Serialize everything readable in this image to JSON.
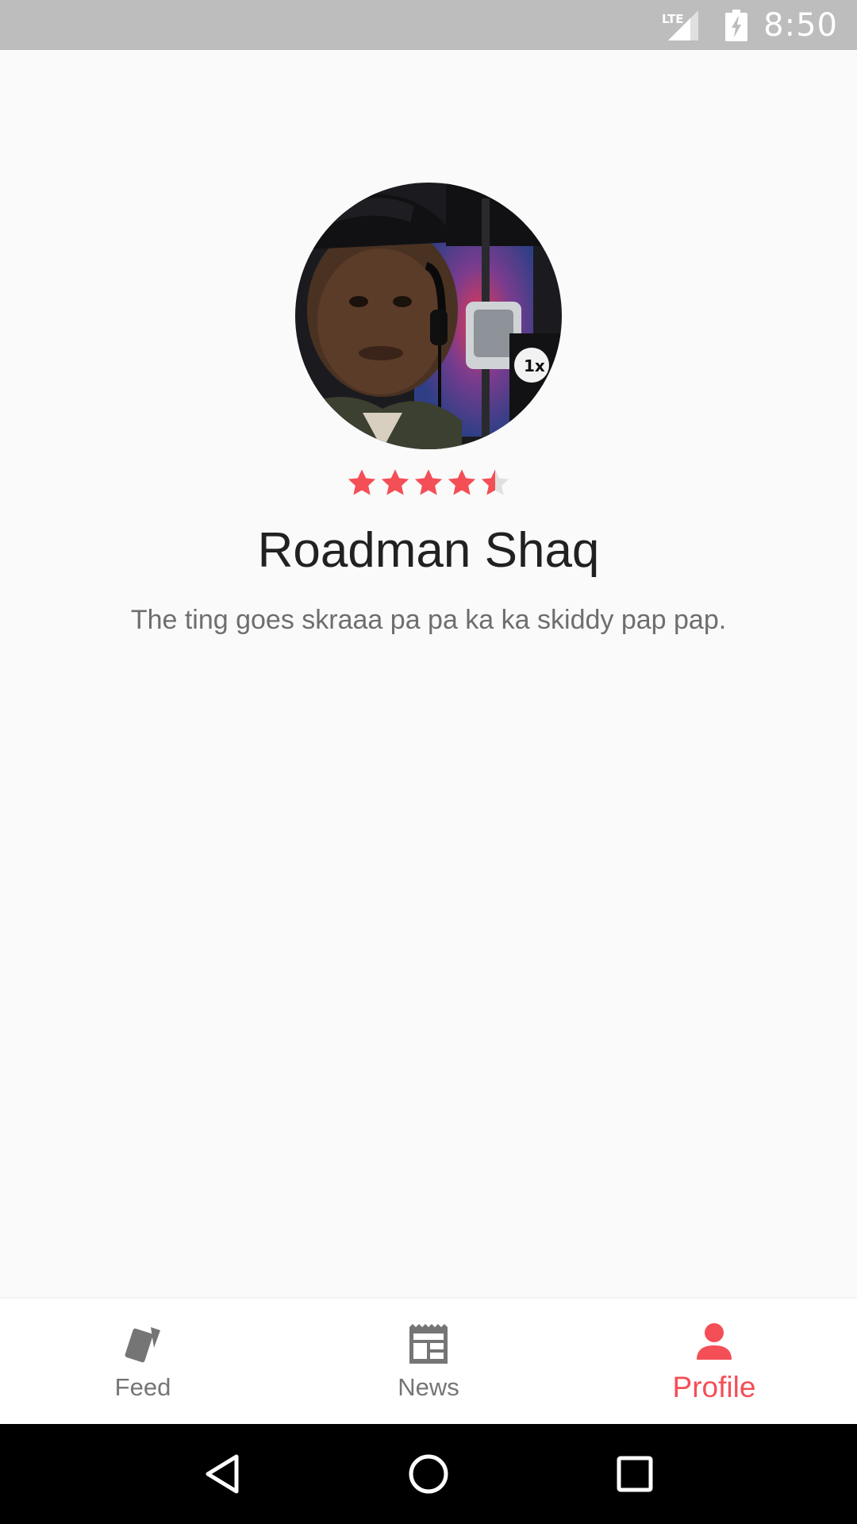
{
  "status_bar": {
    "network": "LTE",
    "time": "8:50"
  },
  "profile": {
    "name": "Roadman Shaq",
    "bio": "The ting goes skraaa pa pa ka ka skiddy pap pap.",
    "rating": {
      "value": 4.5,
      "max": 5
    },
    "avatar_icon": "profile-photo"
  },
  "bottom_nav": {
    "items": [
      {
        "label": "Feed",
        "icon": "cards-icon",
        "active": false
      },
      {
        "label": "News",
        "icon": "newspaper-icon",
        "active": false
      },
      {
        "label": "Profile",
        "icon": "person-icon",
        "active": true
      }
    ]
  },
  "colors": {
    "accent": "#f44e57",
    "inactive": "#757575",
    "background": "#fafafa",
    "status_bar": "#bdbdbd"
  }
}
